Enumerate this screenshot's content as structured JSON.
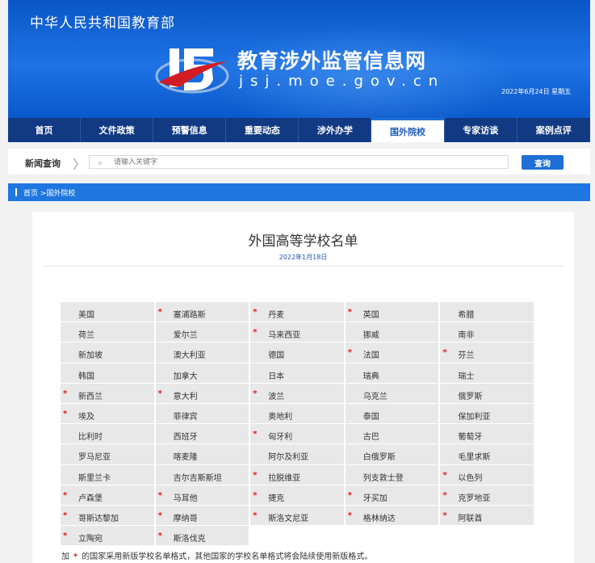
{
  "header": {
    "ministry": "中华人民共和国教育部",
    "site_title": "教育涉外监管信息网",
    "domain": "jsj.moe.gov.cn",
    "date": "2022年6月24日 星期五"
  },
  "nav": {
    "items": [
      {
        "label": "首页"
      },
      {
        "label": "文件政策"
      },
      {
        "label": "预警信息"
      },
      {
        "label": "重要动态"
      },
      {
        "label": "涉外办学"
      },
      {
        "label": "国外院校",
        "active": true
      },
      {
        "label": "专家访谈"
      },
      {
        "label": "案例点评"
      }
    ]
  },
  "search": {
    "label": "新闻查询",
    "placeholder": "请输入关键字",
    "button": "查询"
  },
  "breadcrumb": {
    "text": "首页 >国外院校"
  },
  "article": {
    "title": "外国高等学校名单",
    "date": "2022年1月18日"
  },
  "countries": [
    {
      "name": "美国",
      "star": false
    },
    {
      "name": "塞浦路斯",
      "star": true
    },
    {
      "name": "丹麦",
      "star": true
    },
    {
      "name": "英国",
      "star": true
    },
    {
      "name": "希腊",
      "star": false
    },
    {
      "name": "荷兰",
      "star": false
    },
    {
      "name": "爱尔兰",
      "star": false
    },
    {
      "name": "马来西亚",
      "star": true
    },
    {
      "name": "挪威",
      "star": false
    },
    {
      "name": "南非",
      "star": false
    },
    {
      "name": "新加坡",
      "star": false
    },
    {
      "name": "澳大利亚",
      "star": false
    },
    {
      "name": "德国",
      "star": false
    },
    {
      "name": "法国",
      "star": true
    },
    {
      "name": "芬兰",
      "star": true
    },
    {
      "name": "韩国",
      "star": false
    },
    {
      "name": "加拿大",
      "star": false
    },
    {
      "name": "日本",
      "star": false
    },
    {
      "name": "瑞典",
      "star": false
    },
    {
      "name": "瑞士",
      "star": false
    },
    {
      "name": "新西兰",
      "star": true
    },
    {
      "name": "意大利",
      "star": true
    },
    {
      "name": "波兰",
      "star": true
    },
    {
      "name": "乌克兰",
      "star": false
    },
    {
      "name": "俄罗斯",
      "star": false
    },
    {
      "name": "埃及",
      "star": true
    },
    {
      "name": "菲律宾",
      "star": false
    },
    {
      "name": "奥地利",
      "star": false
    },
    {
      "name": "泰国",
      "star": false
    },
    {
      "name": "保加利亚",
      "star": false
    },
    {
      "name": "比利时",
      "star": false
    },
    {
      "name": "西班牙",
      "star": false
    },
    {
      "name": "匈牙利",
      "star": true
    },
    {
      "name": "古巴",
      "star": false
    },
    {
      "name": "葡萄牙",
      "star": false
    },
    {
      "name": "罗马尼亚",
      "star": false
    },
    {
      "name": "喀麦隆",
      "star": false
    },
    {
      "name": "阿尔及利亚",
      "star": false
    },
    {
      "name": "白俄罗斯",
      "star": false
    },
    {
      "name": "毛里求斯",
      "star": false
    },
    {
      "name": "斯里兰卡",
      "star": false
    },
    {
      "name": "吉尔吉斯斯坦",
      "star": false
    },
    {
      "name": "拉脱维亚",
      "star": true
    },
    {
      "name": "列支敦士登",
      "star": false
    },
    {
      "name": "以色列",
      "star": true
    },
    {
      "name": "卢森堡",
      "star": true
    },
    {
      "name": "马耳他",
      "star": true
    },
    {
      "name": "捷克",
      "star": true
    },
    {
      "name": "牙买加",
      "star": true
    },
    {
      "name": "克罗地亚",
      "star": true
    },
    {
      "name": "哥斯达黎加",
      "star": true
    },
    {
      "name": "摩纳哥",
      "star": true
    },
    {
      "name": "斯洛文尼亚",
      "star": true
    },
    {
      "name": "格林纳达",
      "star": true
    },
    {
      "name": "阿联酋",
      "star": true
    },
    {
      "name": "立陶宛",
      "star": true
    },
    {
      "name": "斯洛伐克",
      "star": true
    }
  ],
  "note": {
    "prefix": "加",
    "star": "*",
    "text": "的国家采用新版学校名单格式，其他国家的学校名单格式将会陆续使用新版格式。"
  },
  "colors": {
    "banner": "#1f73e4",
    "nav": "#123a83",
    "accent": "#1e6fd8",
    "star": "#e0191b"
  }
}
